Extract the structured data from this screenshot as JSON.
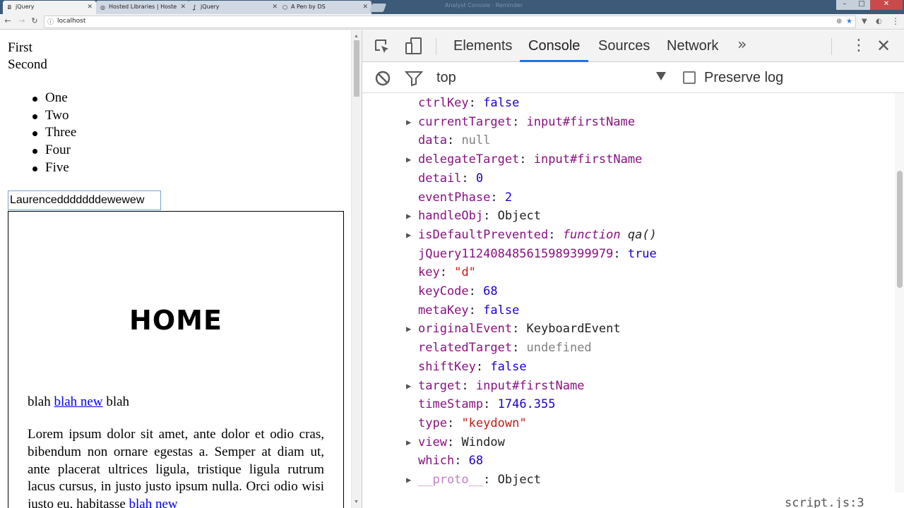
{
  "browser": {
    "tabs": [
      {
        "title": "jQuery",
        "favicon": "wordpress-w"
      },
      {
        "title": "Hosted Libraries | Hoste",
        "favicon": "globe"
      },
      {
        "title": "jQuery",
        "favicon": "jquery-swirl"
      },
      {
        "title": "A Pen by DS",
        "favicon": "codepen"
      }
    ],
    "window_title": "Analyst Console · Reminder",
    "url": "localhost"
  },
  "page": {
    "line_first": "First",
    "line_second": "Second",
    "list": [
      "One",
      "Two",
      "Three",
      "Four",
      "Five"
    ],
    "input_value": "Laurencedddddddewewew",
    "box_heading": "HOME",
    "blah_before": "blah",
    "blah_link": "blah new",
    "blah_after": "blah",
    "lorem_text": "Lorem ipsum dolor sit amet, ante dolor et odio cras, bibendum non ornare egestas a. Semper at diam ut, ante placerat ultrices ligula, tristique ligula rutrum lacus cursus, in justo justo ipsum nulla. Orci odio wisi justo eu, habitasse",
    "lorem_link": "blah new"
  },
  "devtools": {
    "tabs": [
      "Elements",
      "Console",
      "Sources",
      "Network"
    ],
    "active_tab": "Console",
    "context": "top",
    "preserve_log_label": "Preserve log",
    "preserve_log_checked": false,
    "properties": [
      {
        "key": "ctrlKey",
        "value": "false",
        "type": "bool",
        "expandable": false
      },
      {
        "key": "currentTarget",
        "value": "input#firstName",
        "type": "node",
        "expandable": true
      },
      {
        "key": "data",
        "value": "null",
        "type": "null",
        "expandable": false
      },
      {
        "key": "delegateTarget",
        "value": "input#firstName",
        "type": "node",
        "expandable": true
      },
      {
        "key": "detail",
        "value": "0",
        "type": "num",
        "expandable": false
      },
      {
        "key": "eventPhase",
        "value": "2",
        "type": "num",
        "expandable": false
      },
      {
        "key": "handleObj",
        "value": "Object",
        "type": "obj",
        "expandable": true
      },
      {
        "key": "isDefaultPrevented",
        "value": "function",
        "extra": "qa()",
        "type": "func",
        "expandable": true
      },
      {
        "key": "jQuery112408485615989399979",
        "value": "true",
        "type": "bool",
        "expandable": false
      },
      {
        "key": "key",
        "value": "\"d\"",
        "type": "str",
        "expandable": false
      },
      {
        "key": "keyCode",
        "value": "68",
        "type": "num",
        "expandable": false
      },
      {
        "key": "metaKey",
        "value": "false",
        "type": "bool",
        "expandable": false
      },
      {
        "key": "originalEvent",
        "value": "KeyboardEvent",
        "type": "obj",
        "expandable": true
      },
      {
        "key": "relatedTarget",
        "value": "undefined",
        "type": "null",
        "expandable": false
      },
      {
        "key": "shiftKey",
        "value": "false",
        "type": "bool",
        "expandable": false
      },
      {
        "key": "target",
        "value": "input#firstName",
        "type": "node",
        "expandable": true
      },
      {
        "key": "timeStamp",
        "value": "1746.355",
        "type": "num",
        "expandable": false
      },
      {
        "key": "type",
        "value": "\"keydown\"",
        "type": "str",
        "expandable": false
      },
      {
        "key": "view",
        "value": "Window",
        "type": "obj",
        "expandable": true
      },
      {
        "key": "which",
        "value": "68",
        "type": "num",
        "expandable": false
      },
      {
        "key": "__proto__",
        "value": "Object",
        "type": "obj",
        "expandable": true,
        "proto": true
      }
    ],
    "source_link": "script.js:3"
  },
  "colors": {
    "tabstrip": "#3d5a78",
    "devtools_accent": "#1a73e8",
    "link": "#0000ee",
    "prop_key": "#881280",
    "number_bool": "#1c00cf",
    "string": "#c41a16",
    "null_gray": "#808080"
  }
}
